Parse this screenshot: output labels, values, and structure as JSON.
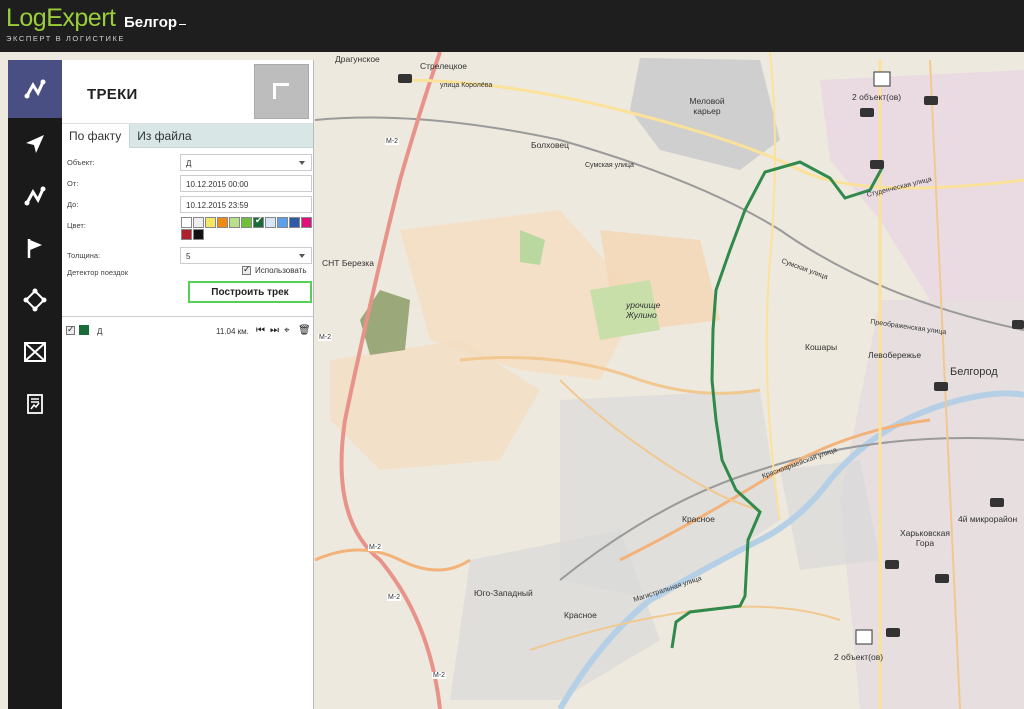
{
  "header": {
    "logo_text": "LogExpert",
    "logo_tagline": "ЭКСПЕРТ В ЛОГИСТИКЕ",
    "city": "Белгор"
  },
  "rail": {
    "items": [
      {
        "icon": "route-icon"
      },
      {
        "icon": "navigation-arrow-icon"
      },
      {
        "icon": "route-icon"
      },
      {
        "icon": "flag-icon"
      },
      {
        "icon": "geofence-icon"
      },
      {
        "icon": "envelope-icon"
      },
      {
        "icon": "report-icon"
      }
    ]
  },
  "panel": {
    "title": "ТРЕКИ",
    "tabs": [
      {
        "label": "По факту",
        "active": true
      },
      {
        "label": "Из файла",
        "active": false
      }
    ],
    "form": {
      "object_label": "Объект:",
      "object_value": "Д",
      "from_label": "От:",
      "from_value": "10.12.2015 00:00",
      "to_label": "До:",
      "to_value": "10.12.2015 23:59",
      "color_label": "Цвет:",
      "colors": [
        "#ffffff",
        "#eeeeee",
        "#f5e663",
        "#f08a10",
        "#b8e08a",
        "#6fbf3a",
        "#1a6b3a",
        "#d6e4f5",
        "#5ba0e8",
        "#2e5ba8",
        "#e0107a",
        "#b0202a",
        "#111111"
      ],
      "selected_color": "#1a6b3a",
      "thickness_label": "Толщина:",
      "thickness_value": "5",
      "detector_label": "Детектор поездок",
      "detector_option": "Использовать",
      "build_button": "Построить трек"
    },
    "tracks": [
      {
        "name": "Д",
        "color": "#1a6b3a",
        "distance": "11.04 км."
      }
    ]
  },
  "map": {
    "labels": {
      "dragunskoe": "Драгунское",
      "streletskoe": "Стрелецкое",
      "korolyova": "улица Королёва",
      "quarry": "Меловой карьер",
      "bolkhovets": "Болховец",
      "sumskaya": "Сумская улица",
      "snt": "СНТ Березка",
      "urochishche": "урочище Жулино",
      "koshary": "Кошары",
      "levoberezhye": "Левобережье",
      "belgorod": "Белгород",
      "krasnoe": "Красное",
      "yugo_zapadny": "Юго-Западный",
      "krasnoe2": "Красное",
      "kharkovskaya": "Харьковская Гора",
      "mikrorayon": "4й микрорайон",
      "objects_top": "2 объект(ов)",
      "objects_bottom": "2 объект(ов)",
      "m2_a": "М-2",
      "m2_b": "М-2",
      "m2_c": "М-2",
      "m2_d": "М-2",
      "m2_e": "М-2",
      "magistral": "Магистральная улица",
      "studencheskaya": "Студенческая улица",
      "preobrazhenskaya": "Преображенская улица",
      "sumskaya2": "Сумская улица",
      "krasnoarmeyskaya": "Красноармейская улица"
    }
  }
}
